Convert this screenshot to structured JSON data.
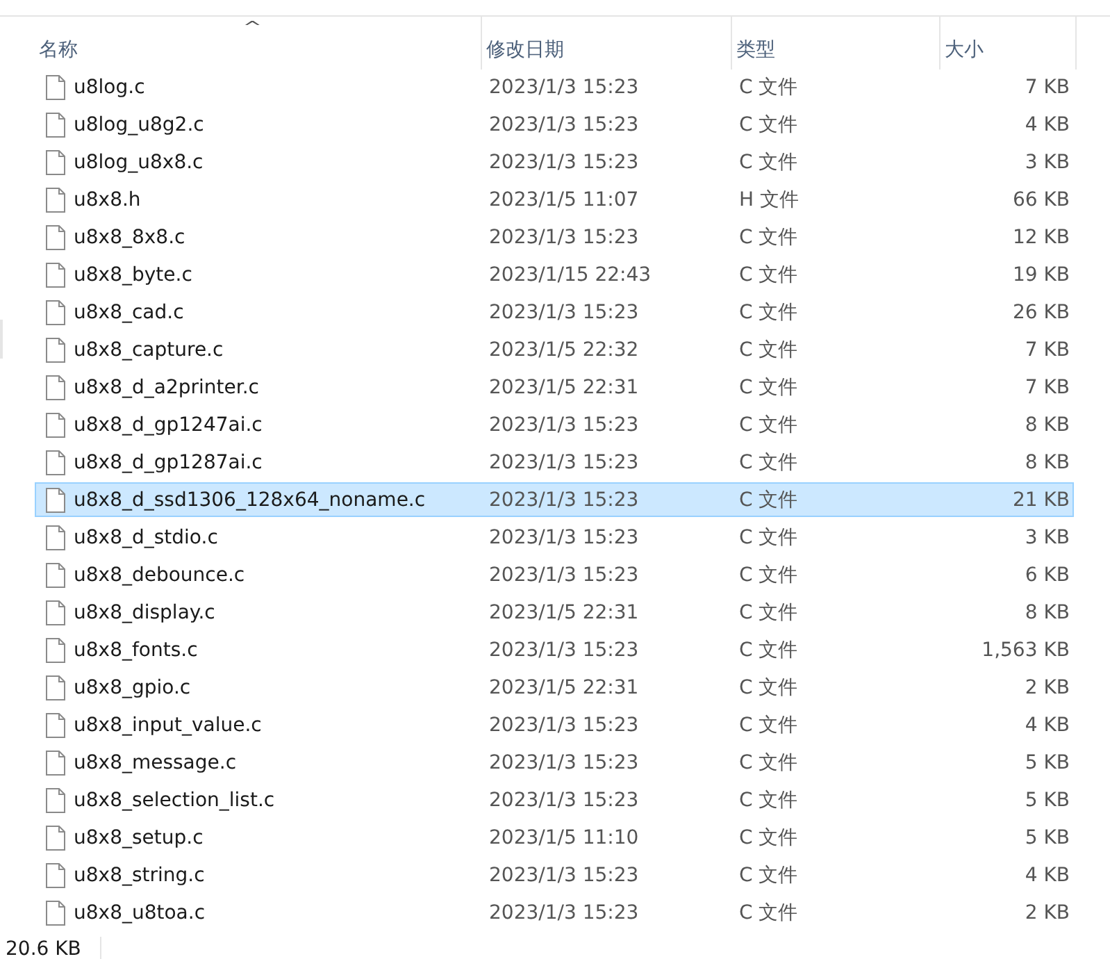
{
  "table": {
    "sort_indicator": "^",
    "columns": [
      "名称",
      "修改日期",
      "类型",
      "大小"
    ],
    "rows": [
      {
        "name": "u8log.c",
        "date": "2023/1/3 15:23",
        "type": "C 文件",
        "size": "7 KB",
        "selected": false
      },
      {
        "name": "u8log_u8g2.c",
        "date": "2023/1/3 15:23",
        "type": "C 文件",
        "size": "4 KB",
        "selected": false
      },
      {
        "name": "u8log_u8x8.c",
        "date": "2023/1/3 15:23",
        "type": "C 文件",
        "size": "3 KB",
        "selected": false
      },
      {
        "name": "u8x8.h",
        "date": "2023/1/5 11:07",
        "type": "H 文件",
        "size": "66 KB",
        "selected": false
      },
      {
        "name": "u8x8_8x8.c",
        "date": "2023/1/3 15:23",
        "type": "C 文件",
        "size": "12 KB",
        "selected": false
      },
      {
        "name": "u8x8_byte.c",
        "date": "2023/1/15 22:43",
        "type": "C 文件",
        "size": "19 KB",
        "selected": false
      },
      {
        "name": "u8x8_cad.c",
        "date": "2023/1/3 15:23",
        "type": "C 文件",
        "size": "26 KB",
        "selected": false
      },
      {
        "name": "u8x8_capture.c",
        "date": "2023/1/5 22:32",
        "type": "C 文件",
        "size": "7 KB",
        "selected": false
      },
      {
        "name": "u8x8_d_a2printer.c",
        "date": "2023/1/5 22:31",
        "type": "C 文件",
        "size": "7 KB",
        "selected": false
      },
      {
        "name": "u8x8_d_gp1247ai.c",
        "date": "2023/1/3 15:23",
        "type": "C 文件",
        "size": "8 KB",
        "selected": false
      },
      {
        "name": "u8x8_d_gp1287ai.c",
        "date": "2023/1/3 15:23",
        "type": "C 文件",
        "size": "8 KB",
        "selected": false
      },
      {
        "name": "u8x8_d_ssd1306_128x64_noname.c",
        "date": "2023/1/3 15:23",
        "type": "C 文件",
        "size": "21 KB",
        "selected": true
      },
      {
        "name": "u8x8_d_stdio.c",
        "date": "2023/1/3 15:23",
        "type": "C 文件",
        "size": "3 KB",
        "selected": false
      },
      {
        "name": "u8x8_debounce.c",
        "date": "2023/1/3 15:23",
        "type": "C 文件",
        "size": "6 KB",
        "selected": false
      },
      {
        "name": "u8x8_display.c",
        "date": "2023/1/5 22:31",
        "type": "C 文件",
        "size": "8 KB",
        "selected": false
      },
      {
        "name": "u8x8_fonts.c",
        "date": "2023/1/3 15:23",
        "type": "C 文件",
        "size": "1,563 KB",
        "selected": false
      },
      {
        "name": "u8x8_gpio.c",
        "date": "2023/1/5 22:31",
        "type": "C 文件",
        "size": "2 KB",
        "selected": false
      },
      {
        "name": "u8x8_input_value.c",
        "date": "2023/1/3 15:23",
        "type": "C 文件",
        "size": "4 KB",
        "selected": false
      },
      {
        "name": "u8x8_message.c",
        "date": "2023/1/3 15:23",
        "type": "C 文件",
        "size": "5 KB",
        "selected": false
      },
      {
        "name": "u8x8_selection_list.c",
        "date": "2023/1/3 15:23",
        "type": "C 文件",
        "size": "5 KB",
        "selected": false
      },
      {
        "name": "u8x8_setup.c",
        "date": "2023/1/5 11:10",
        "type": "C 文件",
        "size": "5 KB",
        "selected": false
      },
      {
        "name": "u8x8_string.c",
        "date": "2023/1/3 15:23",
        "type": "C 文件",
        "size": "4 KB",
        "selected": false
      },
      {
        "name": "u8x8_u8toa.c",
        "date": "2023/1/3 15:23",
        "type": "C 文件",
        "size": "2 KB",
        "selected": false
      }
    ]
  },
  "status_bar": {
    "size": "20.6 KB"
  }
}
